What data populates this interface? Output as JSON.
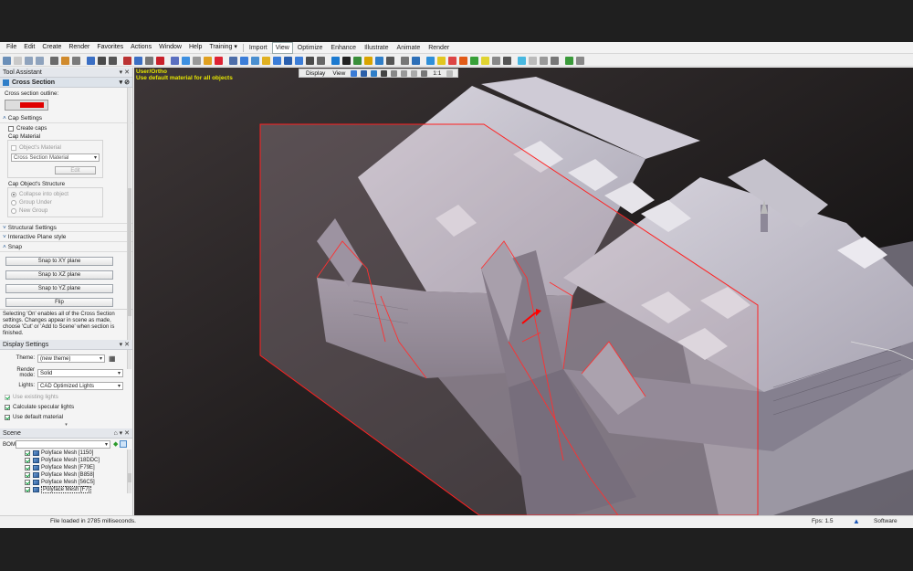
{
  "menubar": {
    "items": [
      "File",
      "Edit",
      "Create",
      "Render",
      "Favorites",
      "Actions",
      "Window",
      "Help",
      "Training ▾"
    ],
    "mode_tabs": [
      "Import",
      "View",
      "Optimize",
      "Enhance",
      "Illustrate",
      "Animate",
      "Render"
    ],
    "active_tab": "View"
  },
  "tool_assistant": {
    "title": "Tool Assistant",
    "panel_title": "Cross Section",
    "outline_label": "Cross section outline:",
    "outline_color": "#e00000",
    "cap_settings": {
      "header": "Cap Settings",
      "create_caps": "Create caps",
      "cap_material_label": "Cap Material",
      "objects_material": "Object's Material",
      "material_select": "Cross Section Material",
      "edit_button": "Edit",
      "structure_label": "Cap Object's Structure",
      "options": [
        "Collapse into object",
        "Group Under",
        "New Group"
      ]
    },
    "structural_settings": "Structural Settings",
    "interactive_plane_style": "Interactive Plane style",
    "snap": {
      "header": "Snap",
      "buttons": [
        "Snap to XY plane",
        "Snap to XZ plane",
        "Snap to YZ plane",
        "Flip"
      ]
    },
    "help_text": "Selecting 'On' enables all of the Cross Section settings. Changes appear in scene as made, choose 'Cut' or 'Add to Scene' when section is finished."
  },
  "display_settings": {
    "title": "Display Settings",
    "theme_label": "Theme:",
    "theme_value": "(new theme)",
    "render_mode_label": "Render mode:",
    "render_mode_value": "Solid",
    "lights_label": "Lights:",
    "lights_value": "CAD Optimized Lights",
    "use_existing_lights": "Use existing lights",
    "calc_specular": "Calculate specular lights",
    "use_default_material": "Use default material"
  },
  "scene": {
    "title": "Scene",
    "bom_label": "BOM:",
    "items": [
      "Polyface Mesh [1150]",
      "Polyface Mesh [18DDC]",
      "Polyface Mesh [F79E]",
      "Polyface Mesh [B858]",
      "Polyface Mesh [56C5]",
      "Polyface Mesh [F7]"
    ]
  },
  "viewport": {
    "toolbar": {
      "display": "Display",
      "view": "View",
      "zoom": "1:1"
    },
    "label_line1": "User/Ortho",
    "label_line2": "Use default material for all objects"
  },
  "statusbar": {
    "message": "File loaded in 2785 milliseconds.",
    "fps": "Fps: 1.5",
    "renderer": "Software"
  }
}
